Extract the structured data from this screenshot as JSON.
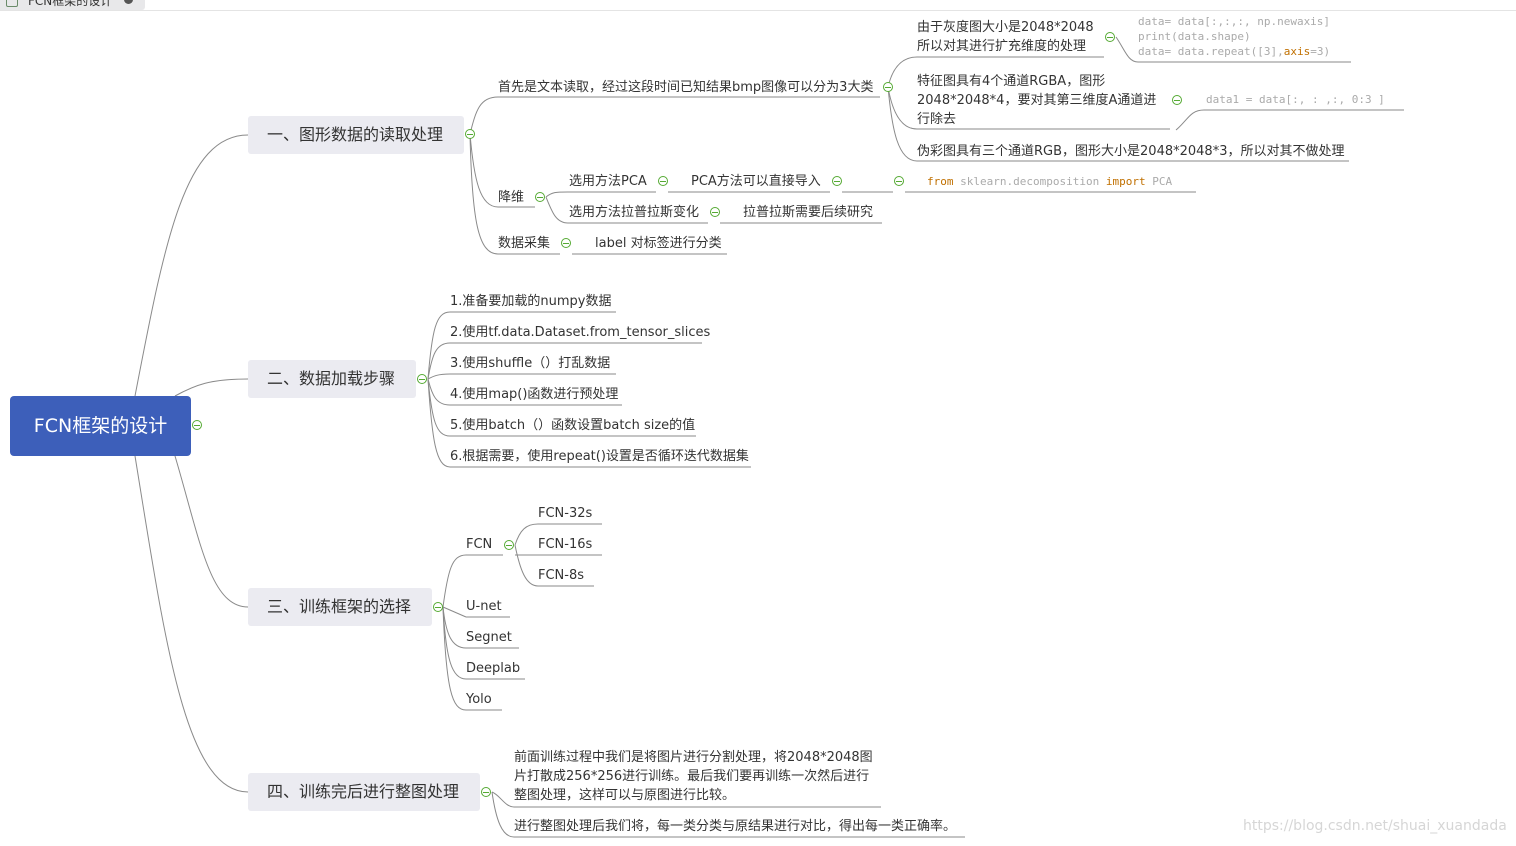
{
  "tab": {
    "title": "FCN框架的设计"
  },
  "root": {
    "label": "FCN框架的设计"
  },
  "branch1": {
    "label": "一、图形数据的读取处理",
    "text_read": {
      "label": "首先是文本读取，经过这段时间已知结果bmp图像可以分为3大类",
      "gray": {
        "line1": "由于灰度图大小是2048*2048",
        "line2": "所以对其进行扩充维度的处理",
        "code_line1": "data= data[:,:,:, np.newaxis]",
        "code_line2": "print(data.shape)",
        "code_line3a": "data= data.repeat([3],",
        "code_line3b": "axis",
        "code_line3c": "=3)"
      },
      "rgba": {
        "text": "特征图具有4个通道RGBA，图形2048*2048*4，要对其第三维度A通道进行除去",
        "code": "data1 = data[:, : ,:, 0:3 ]"
      },
      "pseudo": {
        "text": "伪彩图具有三个通道RGB，图形大小是2048*2048*3，所以对其不做处理"
      }
    },
    "reduce": {
      "label": "降维",
      "pca": {
        "label": "选用方法PCA",
        "child": "PCA方法可以直接导入",
        "code_from": "from",
        "code_mod": " sklearn.decomposition ",
        "code_import": "import",
        "code_cls": " PCA"
      },
      "laplace": {
        "label": "选用方法拉普拉斯变化",
        "child": "拉普拉斯需要后续研究"
      }
    },
    "collect": {
      "label": "数据采集",
      "child": "label 对标签进行分类"
    }
  },
  "branch2": {
    "label": "二、数据加载步骤",
    "steps": [
      "1.准备要加载的numpy数据",
      "2.使用tf.data.Dataset.from_tensor_slices",
      "3.使用shuffle（）打乱数据",
      "4.使用map()函数进行预处理",
      "5.使用batch（）函数设置batch size的值",
      "6.根据需要，使用repeat()设置是否循环迭代数据集"
    ]
  },
  "branch3": {
    "label": "三、训练框架的选择",
    "fcn": {
      "label": "FCN",
      "children": [
        "FCN-32s",
        "FCN-16s",
        "FCN-8s"
      ]
    },
    "others": [
      "U-net",
      "Segnet",
      "Deeplab",
      "Yolo"
    ]
  },
  "branch4": {
    "label": "四、训练完后进行整图处理",
    "item1": "前面训练过程中我们是将图片进行分割处理，将2048*2048图片打散成256*256进行训练。最后我们要再训练一次然后进行整图处理，这样可以与原图进行比较。",
    "item2": "进行整图处理后我们将，每一类分类与原结果进行对比，得出每一类正确率。"
  },
  "watermark": "https://blog.csdn.net/shuai_xuandada",
  "colors": {
    "root_bg": "#3d5fba",
    "main_bg": "#ebebf1",
    "line": "#8a8a8a",
    "toggle": "#55aa33",
    "code_keyword": "#c07000"
  }
}
